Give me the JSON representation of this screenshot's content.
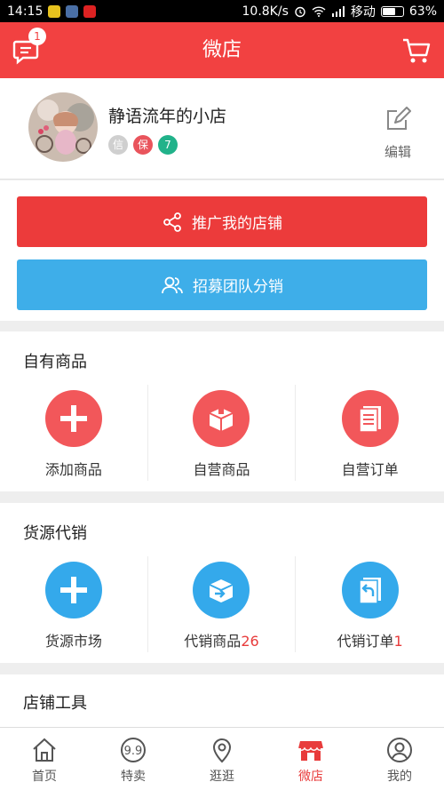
{
  "status_bar": {
    "time": "14:15",
    "network_speed": "10.8K/s",
    "carrier": "移动",
    "battery": "63%",
    "battery_level": 0.63
  },
  "header": {
    "title": "微店",
    "message_count": "1",
    "icons": {
      "left": "message-icon",
      "right": "cart-icon"
    }
  },
  "shop": {
    "name": "静语流年的小店",
    "badges": [
      {
        "text": "信",
        "color": "#cfcfcf"
      },
      {
        "text": "保",
        "color": "#e9545c"
      },
      {
        "text": "7",
        "color": "#21b28a"
      }
    ],
    "edit_label": "编辑"
  },
  "actions": {
    "promote": "推广我的店铺",
    "recruit": "招募团队分销"
  },
  "own_goods": {
    "title": "自有商品",
    "items": [
      {
        "label": "添加商品",
        "icon": "plus-icon"
      },
      {
        "label": "自营商品",
        "icon": "box-icon"
      },
      {
        "label": "自营订单",
        "icon": "document-icon"
      }
    ]
  },
  "supply": {
    "title": "货源代销",
    "items": [
      {
        "label": "货源市场",
        "count": "",
        "icon": "plus-icon"
      },
      {
        "label": "代销商品",
        "count": "26",
        "icon": "box-arrow-icon"
      },
      {
        "label": "代销订单",
        "count": "1",
        "icon": "document-return-icon"
      }
    ]
  },
  "tools": {
    "title": "店铺工具"
  },
  "tabs": [
    {
      "label": "首页",
      "icon": "home-icon"
    },
    {
      "label": "特卖",
      "icon": "sale-icon"
    },
    {
      "label": "逛逛",
      "icon": "location-icon"
    },
    {
      "label": "微店",
      "icon": "shop-icon",
      "active": true
    },
    {
      "label": "我的",
      "icon": "user-icon"
    }
  ],
  "colors": {
    "brand_red": "#f24141",
    "button_blue": "#3eaee9",
    "icon_red": "#f2575a",
    "icon_blue": "#34a9eb"
  }
}
